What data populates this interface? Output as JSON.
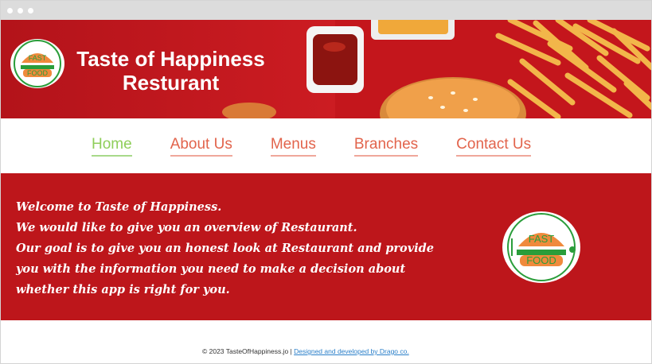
{
  "header": {
    "title_line1": "Taste of Happiness",
    "title_line2": "Resturant",
    "logo_text": "FAST FOOD"
  },
  "nav": {
    "items": [
      {
        "label": "Home",
        "active": true
      },
      {
        "label": "About Us",
        "active": false
      },
      {
        "label": "Menus",
        "active": false
      },
      {
        "label": "Branches",
        "active": false
      },
      {
        "label": "Contact Us",
        "active": false
      }
    ]
  },
  "welcome": {
    "lines": [
      "Welcome to Taste of Happiness.",
      "We would like to give you an overview of Restaurant.",
      "Our goal is to give you an honest look at Restaurant and provide",
      "you with the information you need to make a decision about",
      "whether this app is right for you."
    ]
  },
  "footer": {
    "copyright": "© 2023 TasteOfHappiness.jo |",
    "credit_link": "Designed and developed by Drago co."
  },
  "colors": {
    "brand_red": "#c4161c",
    "nav_active": "#8fce5a",
    "nav_inactive": "#e2644c",
    "link_blue": "#2a7fc9",
    "logo_green": "#2a9d3a",
    "logo_orange": "#f08a3c"
  }
}
